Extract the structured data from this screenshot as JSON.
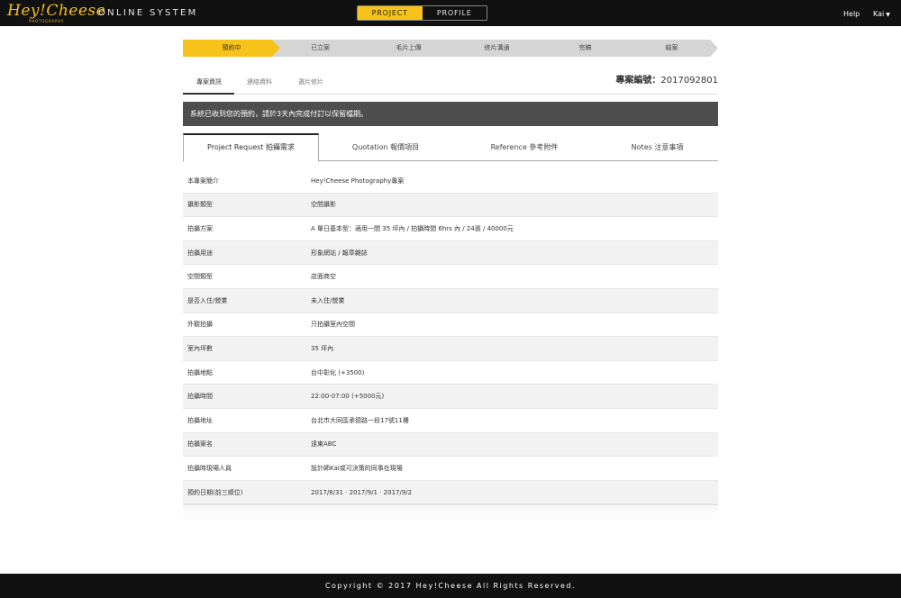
{
  "header": {
    "logo_text": "Hey!Cheese",
    "logo_sub": "PHOTOGRAPHY",
    "system_name": "ONLINE SYSTEM",
    "tabs": [
      {
        "label": "PROJECT",
        "active": true
      },
      {
        "label": "PROFILE",
        "active": false
      }
    ],
    "help_label": "Help",
    "user_name": "Kai"
  },
  "progress_steps": [
    {
      "label": "預約中",
      "active": true
    },
    {
      "label": "已立案",
      "active": false
    },
    {
      "label": "毛片上傳",
      "active": false
    },
    {
      "label": "修片溝通",
      "active": false
    },
    {
      "label": "完稿",
      "active": false
    },
    {
      "label": "結案",
      "active": false
    }
  ],
  "subtabs": [
    {
      "label": "專案資訊",
      "active": true
    },
    {
      "label": "連絡資料",
      "active": false
    },
    {
      "label": "選片修片",
      "active": false
    }
  ],
  "case_number": {
    "label": "專案編號：",
    "value": "2017092801"
  },
  "notice": "系統已收到您的預約，請於3天內完成付訂以保留檔期。",
  "main_tabs": [
    {
      "label": "Project Request 拍攝需求",
      "active": true
    },
    {
      "label": "Quotation 報價項目",
      "active": false
    },
    {
      "label": "Reference 參考附件",
      "active": false
    },
    {
      "label": "Notes 注意事項",
      "active": false
    }
  ],
  "details": [
    {
      "label": "本專案簡介",
      "value": "Hey!Cheese Photography專案"
    },
    {
      "label": "攝影類型",
      "value": "空間攝影"
    },
    {
      "label": "拍攝方案",
      "value": "A 單日基本型：適用一間 35 坪內 / 拍攝時間 6hrs 內 / 24張 / 40000元"
    },
    {
      "label": "拍攝用途",
      "value": "形象網站 / 報章雜誌"
    },
    {
      "label": "空間類型",
      "value": "店面商空"
    },
    {
      "label": "是否入住/營業",
      "value": "未入住/營業"
    },
    {
      "label": "外觀拍攝",
      "value": "只拍攝室內空間"
    },
    {
      "label": "室內坪數",
      "value": "35 坪內"
    },
    {
      "label": "拍攝地點",
      "value": "台中彰化 (+3500)"
    },
    {
      "label": "拍攝時間",
      "value": "22:00-07:00 (+5000元)"
    },
    {
      "label": "拍攝地址",
      "value": "台北市大同區承德路一段17號11樓"
    },
    {
      "label": "拍攝案名",
      "value": "遠東ABC"
    },
    {
      "label": "拍攝時現場人員",
      "value": "設計師Kai或可決策的同事在現場"
    },
    {
      "label": "預約日期(前三順位)",
      "value": "2017/8/31 · 2017/9/1 · 2017/9/2"
    }
  ],
  "footer": "Copyright © 2017 Hey!Cheese All Rights Reserved.",
  "colors": {
    "accent": "#f7c21a",
    "topbar": "#111111",
    "notice_bg": "#4e4e4e"
  }
}
